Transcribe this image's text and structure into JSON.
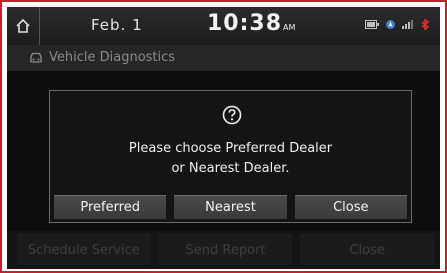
{
  "status_bar": {
    "date": "Feb.  1",
    "time": "10:38",
    "ampm": "AM",
    "icons": [
      "home-icon",
      "battery-icon",
      "location-icon",
      "signal-icon",
      "bluetooth-icon"
    ]
  },
  "title_bar": {
    "icon": "car-diagnostics-icon",
    "title": "Vehicle Diagnostics"
  },
  "bottom_buttons": [
    {
      "label": "Schedule Service"
    },
    {
      "label": "Send Report"
    },
    {
      "label": "Close"
    }
  ],
  "dialog": {
    "icon": "question-icon",
    "line1": "Please choose Preferred Dealer",
    "line2": "or Nearest Dealer.",
    "buttons": [
      {
        "label": "Preferred"
      },
      {
        "label": "Nearest"
      },
      {
        "label": "Close"
      }
    ]
  },
  "colors": {
    "frame_border": "#c8202a",
    "screen_bg": "#1f1f1f",
    "text_primary": "#f0f0f0",
    "text_disabled": "#5e5e5e"
  }
}
